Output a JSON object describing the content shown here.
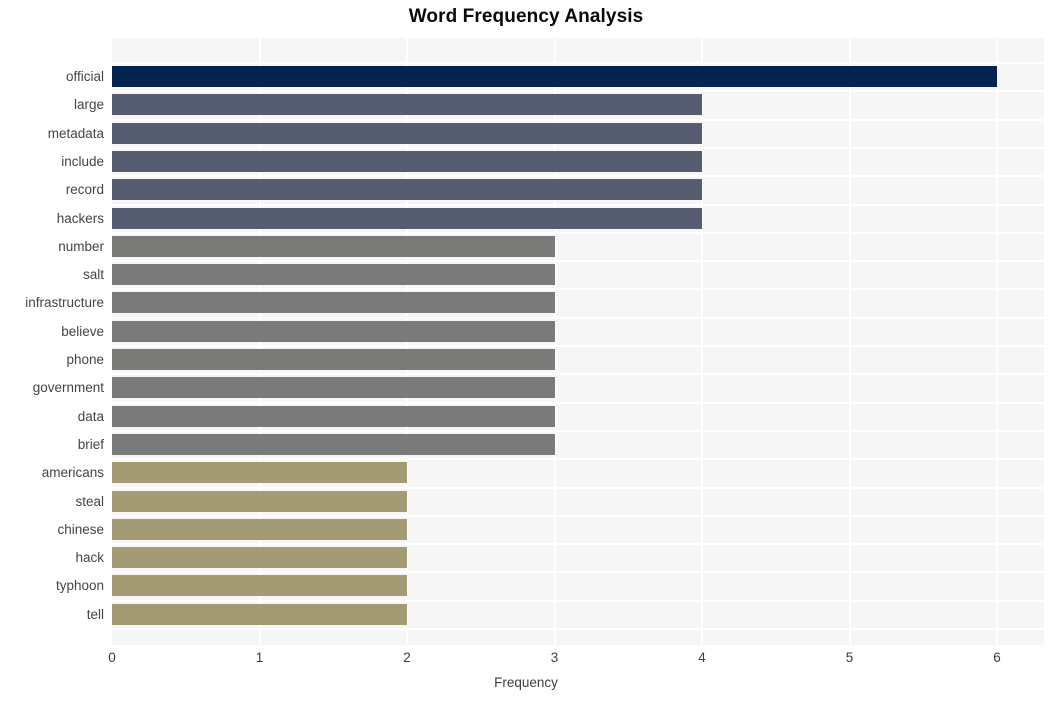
{
  "chart_data": {
    "type": "bar",
    "orientation": "horizontal",
    "title": "Word Frequency Analysis",
    "xlabel": "Frequency",
    "ylabel": "",
    "xlim": [
      0,
      6.32
    ],
    "xticks": [
      0,
      1,
      2,
      3,
      4,
      5,
      6
    ],
    "xtick_labels": [
      "0",
      "1",
      "2",
      "3",
      "4",
      "5",
      "6"
    ],
    "grid": true,
    "legend": null,
    "categories": [
      "official",
      "large",
      "metadata",
      "include",
      "record",
      "hackers",
      "number",
      "salt",
      "infrastructure",
      "believe",
      "phone",
      "government",
      "data",
      "brief",
      "americans",
      "steal",
      "chinese",
      "hack",
      "typhoon",
      "tell"
    ],
    "values": [
      6,
      4,
      4,
      4,
      4,
      4,
      3,
      3,
      3,
      3,
      3,
      3,
      3,
      3,
      2,
      2,
      2,
      2,
      2,
      2
    ],
    "bar_colors": [
      "#042450",
      "#565d70",
      "#565d70",
      "#565d70",
      "#565d70",
      "#565d70",
      "#7a7a78",
      "#7a7a78",
      "#7a7a78",
      "#7a7a78",
      "#7a7a78",
      "#7a7a78",
      "#7a7a78",
      "#7a7a78",
      "#a39b73",
      "#a39b73",
      "#a39b73",
      "#a39b73",
      "#a39b73",
      "#a39b73"
    ],
    "colors": {
      "plot_background": "#f6f6f7",
      "figure_background": "#ffffff",
      "grid": "#ffffff",
      "title_text": "#0a0a0a",
      "tick_text": "#444444"
    }
  }
}
